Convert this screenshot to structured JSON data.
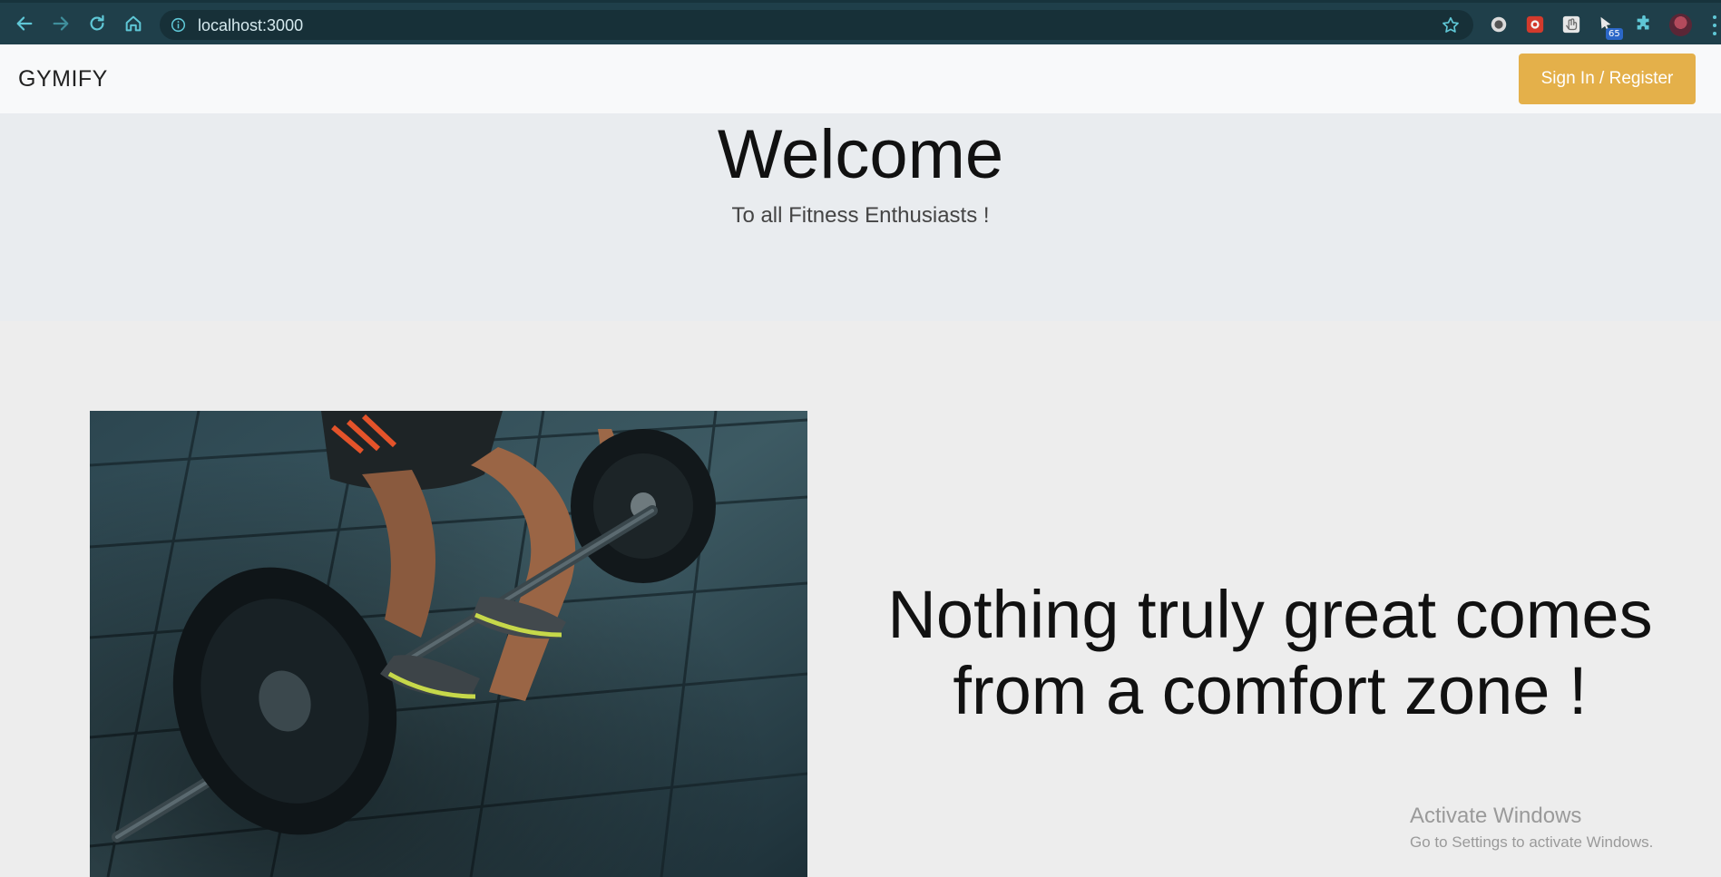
{
  "browser": {
    "url": "localhost:3000",
    "extension_badge": "65",
    "accent_color": "#5fc7d6"
  },
  "navbar": {
    "brand": "GYMIFY",
    "signin_label": "Sign In / Register",
    "signin_color": "#e4b04a"
  },
  "hero": {
    "title": "Welcome",
    "subtitle": "To all Fitness Enthusiasts !"
  },
  "content": {
    "quote": "Nothing truly great comes from a comfort zone !"
  },
  "watermark": {
    "title": "Activate Windows",
    "subtitle": "Go to Settings to activate Windows."
  }
}
